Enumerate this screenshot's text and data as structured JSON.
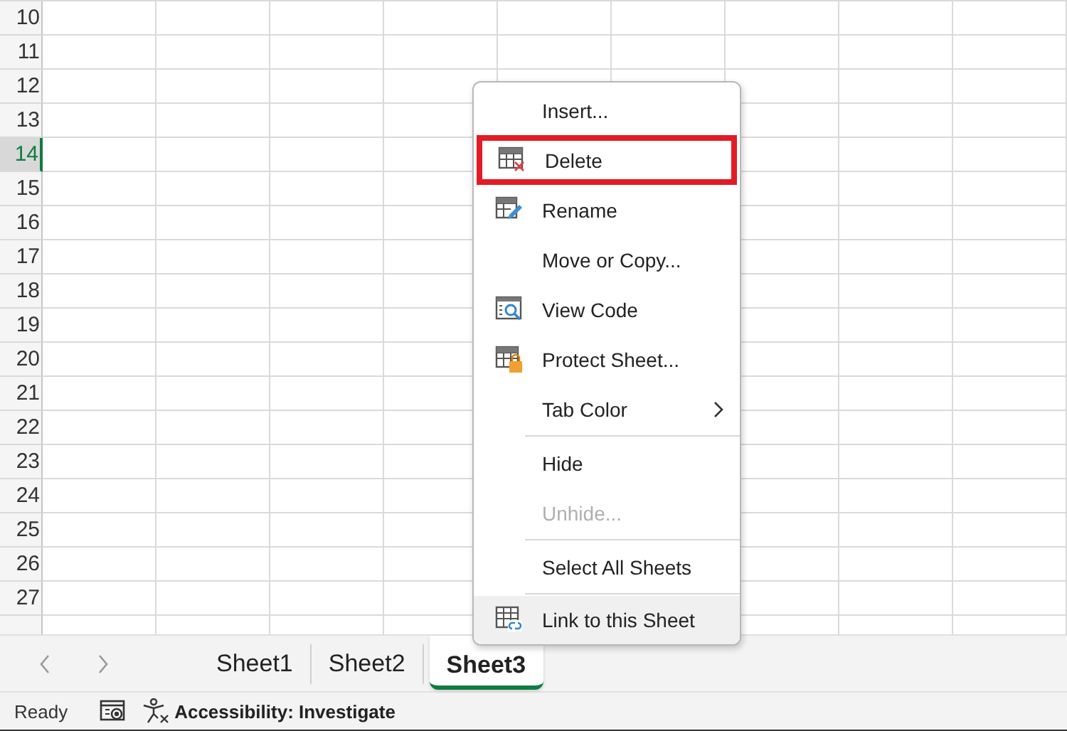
{
  "grid": {
    "rows": [
      {
        "label": "10",
        "selected": false
      },
      {
        "label": "11",
        "selected": false
      },
      {
        "label": "12",
        "selected": false
      },
      {
        "label": "13",
        "selected": false
      },
      {
        "label": "14",
        "selected": true
      },
      {
        "label": "15",
        "selected": false
      },
      {
        "label": "16",
        "selected": false
      },
      {
        "label": "17",
        "selected": false
      },
      {
        "label": "18",
        "selected": false
      },
      {
        "label": "19",
        "selected": false
      },
      {
        "label": "20",
        "selected": false
      },
      {
        "label": "21",
        "selected": false
      },
      {
        "label": "22",
        "selected": false
      },
      {
        "label": "23",
        "selected": false
      },
      {
        "label": "24",
        "selected": false
      },
      {
        "label": "25",
        "selected": false
      },
      {
        "label": "26",
        "selected": false
      },
      {
        "label": "27",
        "selected": false
      }
    ]
  },
  "sheet_tabs": [
    {
      "label": "Sheet1",
      "selected": false
    },
    {
      "label": "Sheet2",
      "selected": false
    },
    {
      "label": "Sheet3",
      "selected": true
    }
  ],
  "context_menu": {
    "items": [
      {
        "label": "Insert...",
        "icon": false,
        "highlighted": false,
        "disabled": false,
        "hovered": false,
        "submenu": false,
        "separator_after": false
      },
      {
        "label": "Delete",
        "icon": true,
        "highlighted": true,
        "disabled": false,
        "hovered": false,
        "submenu": false,
        "separator_after": false
      },
      {
        "label": "Rename",
        "icon": true,
        "highlighted": false,
        "disabled": false,
        "hovered": false,
        "submenu": false,
        "separator_after": false
      },
      {
        "label": "Move or Copy...",
        "icon": false,
        "highlighted": false,
        "disabled": false,
        "hovered": false,
        "submenu": false,
        "separator_after": false
      },
      {
        "label": "View Code",
        "icon": true,
        "highlighted": false,
        "disabled": false,
        "hovered": false,
        "submenu": false,
        "separator_after": false
      },
      {
        "label": "Protect Sheet...",
        "icon": true,
        "highlighted": false,
        "disabled": false,
        "hovered": false,
        "submenu": false,
        "separator_after": false
      },
      {
        "label": "Tab Color",
        "icon": false,
        "highlighted": false,
        "disabled": false,
        "hovered": false,
        "submenu": true,
        "separator_after": true
      },
      {
        "label": "Hide",
        "icon": false,
        "highlighted": false,
        "disabled": false,
        "hovered": false,
        "submenu": false,
        "separator_after": false
      },
      {
        "label": "Unhide...",
        "icon": false,
        "highlighted": false,
        "disabled": true,
        "hovered": false,
        "submenu": false,
        "separator_after": true
      },
      {
        "label": "Select All Sheets",
        "icon": false,
        "highlighted": false,
        "disabled": false,
        "hovered": false,
        "submenu": false,
        "separator_after": true
      },
      {
        "label": "Link to this Sheet",
        "icon": true,
        "highlighted": false,
        "disabled": false,
        "hovered": true,
        "submenu": false,
        "separator_after": false
      }
    ]
  },
  "status_bar": {
    "status": "Ready",
    "accessibility": "Accessibility: Investigate"
  }
}
